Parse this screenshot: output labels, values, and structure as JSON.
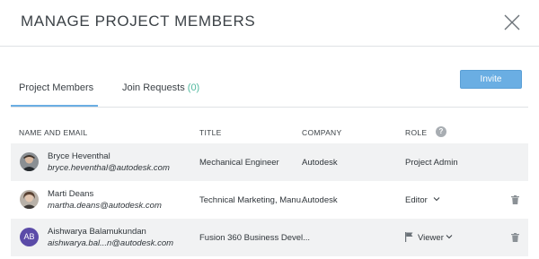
{
  "dialog": {
    "title": "MANAGE PROJECT MEMBERS",
    "close_icon": "close-icon"
  },
  "toolbar": {
    "invite_label": "Invite"
  },
  "tabs": [
    {
      "label": "Project Members",
      "active": true
    },
    {
      "label": "Join Requests",
      "count": "(0)",
      "active": false
    }
  ],
  "columns": {
    "name_email": "NAME AND EMAIL",
    "title": "TITLE",
    "company": "COMPANY",
    "role": "ROLE",
    "role_help": "?"
  },
  "members": [
    {
      "name": "Bryce Heventhal",
      "email": "bryce.heventhal@autodesk.com",
      "title": "Mechanical Engineer",
      "company": "Autodesk",
      "role": "Project Admin",
      "avatar": "photo"
    },
    {
      "name": "Marti Deans",
      "email": "martha.deans@autodesk.com",
      "title": "Technical Marketing, Manu...",
      "company": "Autodesk",
      "role": "Editor",
      "avatar": "photo"
    },
    {
      "name": "Aishwarya Balamukundan",
      "email": "aishwarya.bal...n@autodesk.com",
      "title": "Fusion 360 Business Devel...",
      "company": "",
      "role": "Viewer",
      "avatar": "initials",
      "initials": "AB"
    }
  ],
  "colors": {
    "accent": "#6aaee3",
    "count_green": "#4fb89e",
    "avatar_initials_bg": "#5b4ba8",
    "row_shade": "#f1f2f3"
  }
}
